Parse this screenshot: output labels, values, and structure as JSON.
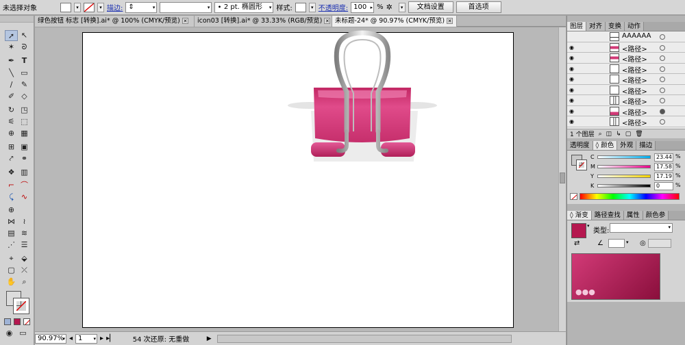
{
  "control_bar": {
    "selection_status": "未选择对象",
    "stroke_label": "描边:",
    "stroke_profile": "2 pt. 椭圆形",
    "style_label": "样式:",
    "opacity_label": "不透明度:",
    "opacity_value": "100",
    "opacity_unit": "%",
    "doc_setup_button": "文档设置",
    "preferences_button": "首选项"
  },
  "tabs": [
    {
      "label": "绿色按钮 标志 [转换].ai* @ 100% (CMYK/预览)",
      "active": false
    },
    {
      "label": "icon03 [转换].ai* @ 33.33% (RGB/预览)",
      "active": false
    },
    {
      "label": "未标题-24* @ 90.97% (CMYK/预览)",
      "active": true
    }
  ],
  "status_bar": {
    "zoom": "90.97%",
    "page": "1",
    "history_status": "54 次还原: 无重做"
  },
  "layers_panel": {
    "tabs": [
      "图层",
      "对齐",
      "变换",
      "动作"
    ],
    "items": [
      {
        "name": "AAAAAA",
        "thumb": "line-light"
      },
      {
        "name": "<路径>",
        "thumb": "pink"
      },
      {
        "name": "<路径>",
        "thumb": "pink"
      },
      {
        "name": "<路径>",
        "thumb": "white"
      },
      {
        "name": "<路径>",
        "thumb": "white"
      },
      {
        "name": "<路径>",
        "thumb": "white"
      },
      {
        "name": "<路径>",
        "thumb": "wire"
      },
      {
        "name": "<路径>",
        "thumb": "pink-small"
      },
      {
        "name": "<路径>",
        "thumb": "wire"
      }
    ],
    "count_label": "1 个图层"
  },
  "color_panel": {
    "tabs": [
      "透明度",
      "颜色",
      "外观",
      "描边"
    ],
    "channels": [
      {
        "label": "C",
        "value": "23.44"
      },
      {
        "label": "M",
        "value": "17.58"
      },
      {
        "label": "Y",
        "value": "17.19"
      },
      {
        "label": "K",
        "value": "0"
      }
    ],
    "percent": "%"
  },
  "gradient_panel": {
    "tabs": [
      "渐变",
      "路径查找",
      "属性",
      "颜色参"
    ],
    "type_label": "类型:",
    "swatch_color": "#b5174f"
  },
  "colors": {
    "clip_pink": "#d6397a",
    "clip_pink_dark": "#a81e57",
    "wire": "#a8a8a8"
  }
}
